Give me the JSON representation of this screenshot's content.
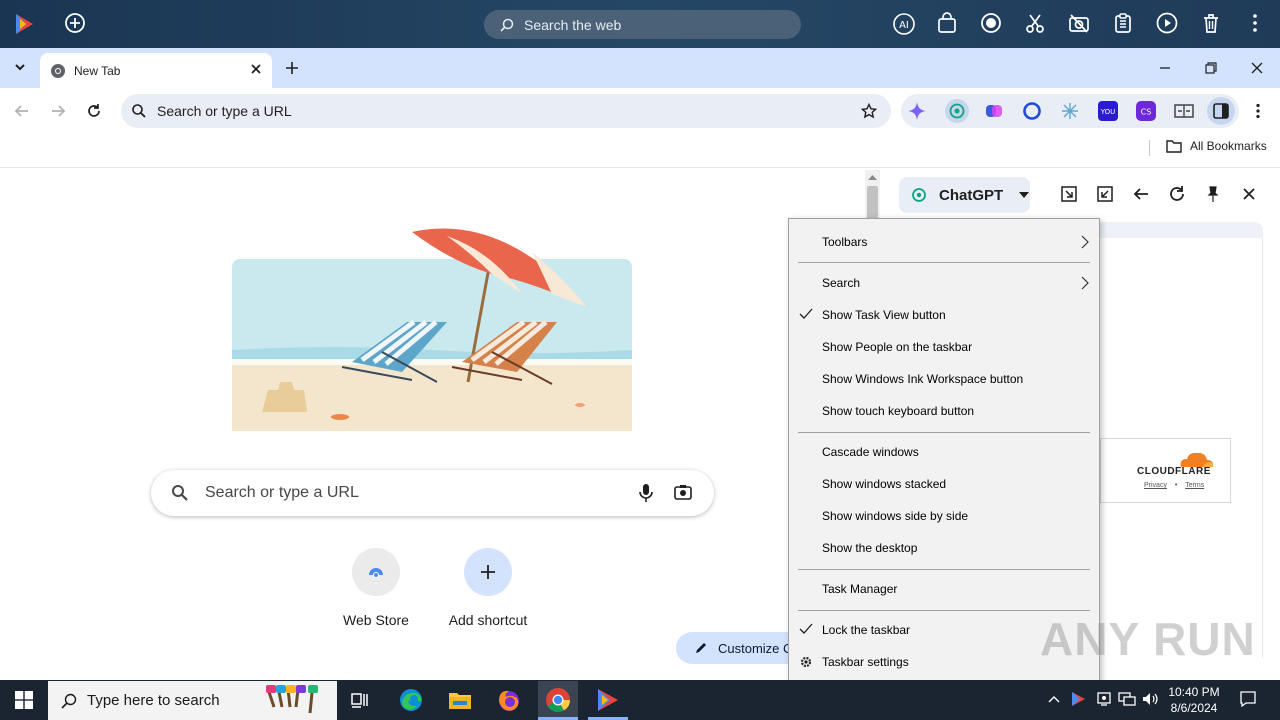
{
  "topbar": {
    "search_label": "Search the web"
  },
  "tab": {
    "title": "New Tab"
  },
  "omnibox": {
    "placeholder": "Search or type a URL"
  },
  "bookmarks": {
    "all_bookmarks": "All Bookmarks"
  },
  "ntp": {
    "search_placeholder": "Search or type a URL",
    "shortcuts": [
      {
        "label": "Web Store",
        "icon": "webstore-icon"
      },
      {
        "label": "Add shortcut",
        "icon": "plus-icon"
      }
    ],
    "customize_label": "Customize C"
  },
  "sidepanel": {
    "selected_app": "ChatGPT",
    "cloudflare": {
      "logo": "CLOUDFLARE",
      "privacy": "Privacy",
      "sep": "•",
      "terms": "Terms"
    }
  },
  "context_menu": {
    "items": [
      {
        "label": "Toolbars",
        "submenu": true,
        "checked": false
      },
      {
        "label": "Search",
        "submenu": true,
        "checked": false
      },
      {
        "label": "Show Task View button",
        "submenu": false,
        "checked": true
      },
      {
        "label": "Show People on the taskbar",
        "submenu": false,
        "checked": false
      },
      {
        "label": "Show Windows Ink Workspace button",
        "submenu": false,
        "checked": false
      },
      {
        "label": "Show touch keyboard button",
        "submenu": false,
        "checked": false
      },
      {
        "label": "Cascade windows",
        "submenu": false,
        "checked": false
      },
      {
        "label": "Show windows stacked",
        "submenu": false,
        "checked": false
      },
      {
        "label": "Show windows side by side",
        "submenu": false,
        "checked": false
      },
      {
        "label": "Show the desktop",
        "submenu": false,
        "checked": false
      },
      {
        "label": "Task Manager",
        "submenu": false,
        "checked": false
      },
      {
        "label": "Lock the taskbar",
        "submenu": false,
        "checked": true
      },
      {
        "label": "Taskbar settings",
        "submenu": false,
        "checked": false
      }
    ]
  },
  "watermark": "ANY RUN",
  "taskbar": {
    "search_placeholder": "Type here to search",
    "time": "10:40 PM",
    "date": "8/6/2024"
  },
  "colors": {
    "topbar": "#1f3b58",
    "tabstrip": "#d3e3fd",
    "omnibox": "#e9eef6",
    "menu_bg": "#f2f2f2",
    "taskbar": "#1b2431"
  }
}
